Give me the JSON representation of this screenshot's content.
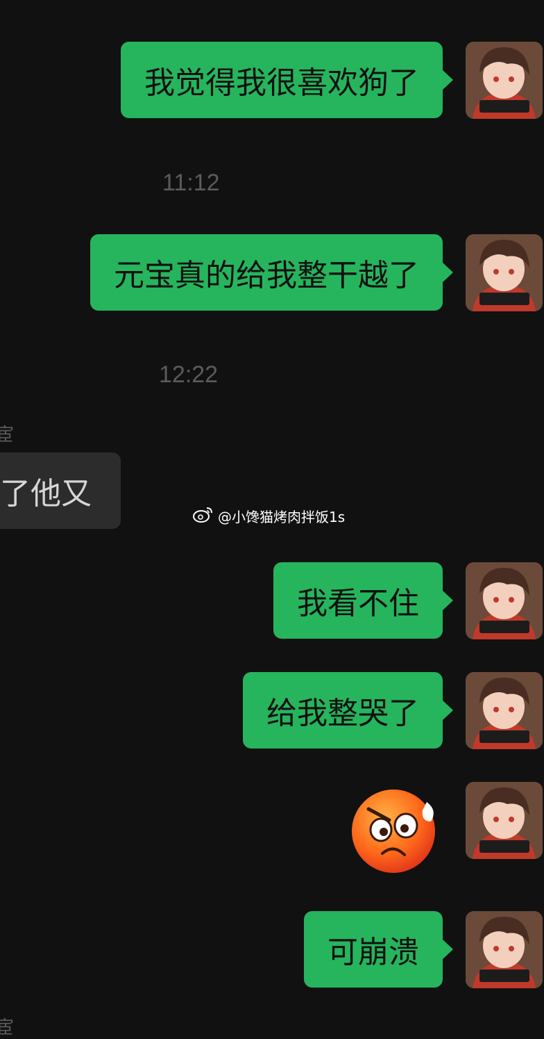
{
  "messages": [
    {
      "side": "out",
      "text": "我觉得我很喜欢狗了"
    },
    {
      "side": "time",
      "text": "11:12"
    },
    {
      "side": "out",
      "text": "元宝真的给我整干越了"
    },
    {
      "side": "time",
      "text": "12:22"
    },
    {
      "side": "in",
      "sender_fragment": "宦",
      "text": "了他又"
    },
    {
      "side": "out",
      "text": "我看不住"
    },
    {
      "side": "out",
      "text": "给我整哭了"
    },
    {
      "side": "out",
      "sticker": "flustered-face-emoji"
    },
    {
      "side": "out",
      "text": "可崩溃"
    }
  ],
  "watermark": {
    "icon": "weibo-icon",
    "text": "@小馋猫烤肉拌饭1s"
  },
  "bottom_fragment": "宦",
  "colors": {
    "background": "#111111",
    "outgoing_bubble": "#26b55d",
    "incoming_bubble": "#2c2c2c",
    "timestamp": "#5b5b5b"
  }
}
